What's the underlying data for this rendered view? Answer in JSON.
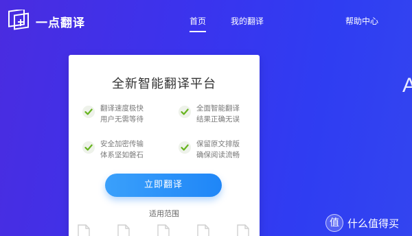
{
  "brand": {
    "name": "一点翻译",
    "icon": "logo-icon"
  },
  "nav": {
    "home": "首页",
    "my_translations": "我的翻译",
    "help": "帮助中心"
  },
  "side_text": "A",
  "card": {
    "title": "全新智能翻译平台",
    "features": [
      {
        "line1": "翻译速度极快",
        "line2": "用户无需等待",
        "icon": "check-icon"
      },
      {
        "line1": "全面智能翻译",
        "line2": "结果正确无误",
        "icon": "check-icon"
      },
      {
        "line1": "安全加密传输",
        "line2": "体系坚如磐石",
        "icon": "check-icon"
      },
      {
        "line1": "保留原文排版",
        "line2": "确保阅读流畅",
        "icon": "check-icon"
      }
    ],
    "button": "立即翻译",
    "scope_label": "适用范围",
    "doc_icons": [
      "document-icon",
      "document-icon",
      "document-icon",
      "document-icon",
      "document-icon"
    ]
  },
  "watermark": {
    "glyph": "值",
    "text": "什么值得买"
  },
  "colors": {
    "background": "#3a34ee",
    "button": "#1f86f7",
    "check": "#67b41f"
  }
}
